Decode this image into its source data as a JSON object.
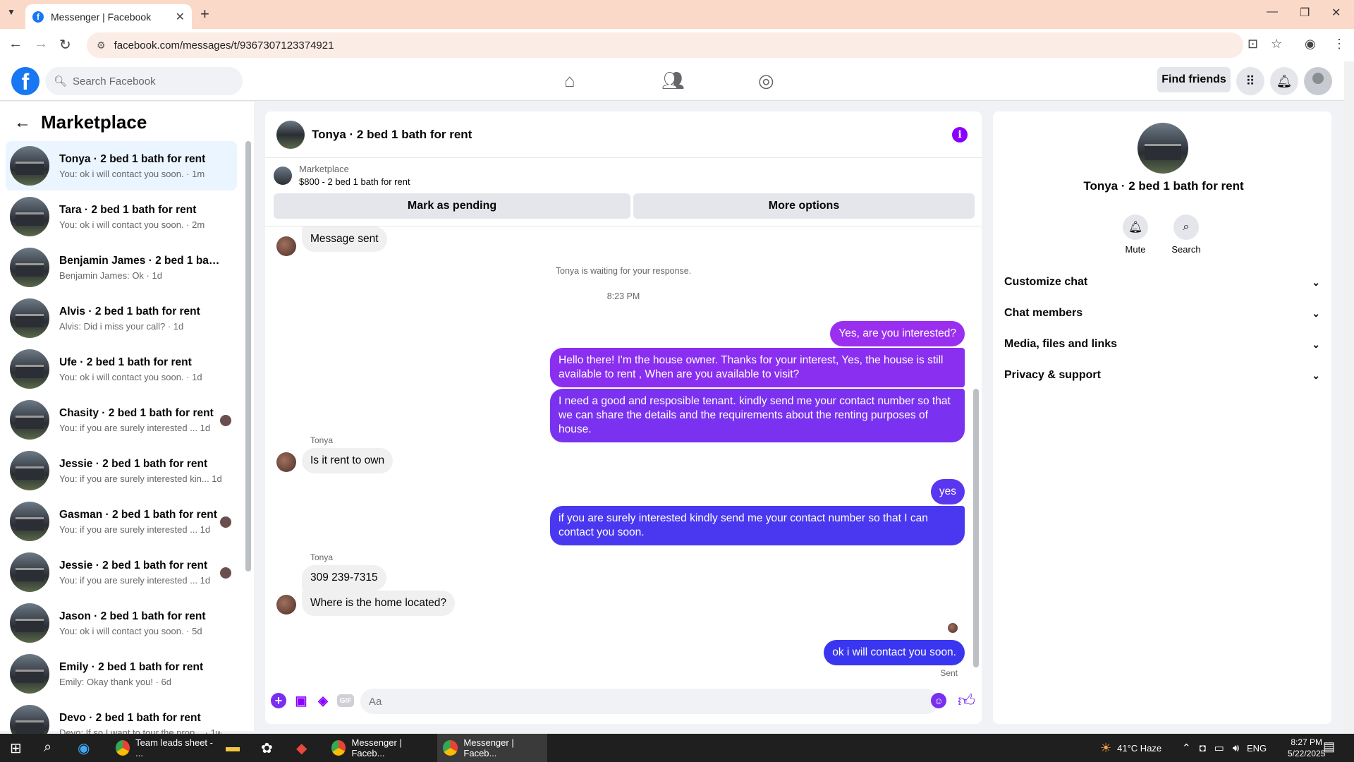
{
  "browser": {
    "tab_title": "Messenger | Facebook",
    "url": "facebook.com/messages/t/9367307123374921"
  },
  "fb_header": {
    "search_placeholder": "Search Facebook",
    "find_friends": "Find friends"
  },
  "sidebar": {
    "title": "Marketplace",
    "conversations": [
      {
        "name": "Tonya · 2 bed 1 bath for rent",
        "snippet": "You: ok i will contact you soon. · 1m"
      },
      {
        "name": "Tara · 2 bed 1 bath for rent",
        "snippet": "You: ok i will contact you soon. · 2m"
      },
      {
        "name": "Benjamin James · 2 bed 1 bath f...",
        "snippet": "Benjamin James: Ok · 1d"
      },
      {
        "name": "Alvis · 2 bed 1 bath for rent",
        "snippet": "Alvis: Did i miss your call? · 1d"
      },
      {
        "name": "Ufe · 2 bed 1 bath for rent",
        "snippet": "You: ok i will contact you soon. · 1d"
      },
      {
        "name": "Chasity · 2 bed 1 bath for rent",
        "snippet": "You: if you are surely interested ...   1d"
      },
      {
        "name": "Jessie · 2 bed 1 bath for rent",
        "snippet": "You: if you are surely interested kin...   1d"
      },
      {
        "name": "Gasman · 2 bed 1 bath for rent",
        "snippet": "You: if you are surely interested ...   1d"
      },
      {
        "name": "Jessie · 2 bed 1 bath for rent",
        "snippet": "You: if you are surely interested ...   1d"
      },
      {
        "name": "Jason · 2 bed 1 bath for rent",
        "snippet": "You: ok i will contact you soon. · 5d"
      },
      {
        "name": "Emily · 2 bed 1 bath for rent",
        "snippet": "Emily: Okay thank you! · 6d"
      },
      {
        "name": "Devo · 2 bed 1 bath for rent",
        "snippet": "Devo: If so I want to tour the prop... · 1w"
      }
    ]
  },
  "chat": {
    "title": "Tonya · 2 bed 1 bath for rent",
    "marketplace_label": "Marketplace",
    "listing": "$800 - 2 bed 1 bath for rent",
    "mark_pending": "Mark as pending",
    "more_options": "More options",
    "msg_sent": "Message sent",
    "waiting": "Tonya is waiting for your response.",
    "time": "8:23 PM",
    "out1": "Yes, are you interested?",
    "out2": "Hello there! I'm the house owner. Thanks for your interest, Yes, the house is still available to rent , When are you available to visit?",
    "out3": "I need a good and resposible tenant.  kindly send me your contact number so that we can share the details and the requirements about the renting purposes of house.",
    "sender1": "Tonya",
    "in1": "Is it rent to own",
    "out4": "yes",
    "out5": "if you are surely interested kindly send me your contact number so that I can contact you soon.",
    "sender2": "Tonya",
    "in2": "309 239-7315",
    "in3": "Where is the home located?",
    "out6": "ok i will contact you soon.",
    "sent": "Sent",
    "composer_placeholder": "Aa",
    "gif_label": "GIF"
  },
  "right_panel": {
    "name": "Tonya · 2 bed 1 bath for rent",
    "mute": "Mute",
    "search": "Search",
    "rows": [
      "Customize chat",
      "Chat members",
      "Media, files and links",
      "Privacy & support"
    ]
  },
  "taskbar": {
    "app1": "Team leads sheet - ...",
    "app2": "Messenger | Faceb...",
    "app3": "Messenger | Faceb...",
    "weather": "41°C  Haze",
    "lang": "ENG",
    "time": "8:27 PM",
    "date": "5/22/2025"
  },
  "colors": {
    "purple_bubble": "#8c2ff0",
    "blue_bubble": "#3a36f0",
    "fb_blue": "#1877f2"
  }
}
